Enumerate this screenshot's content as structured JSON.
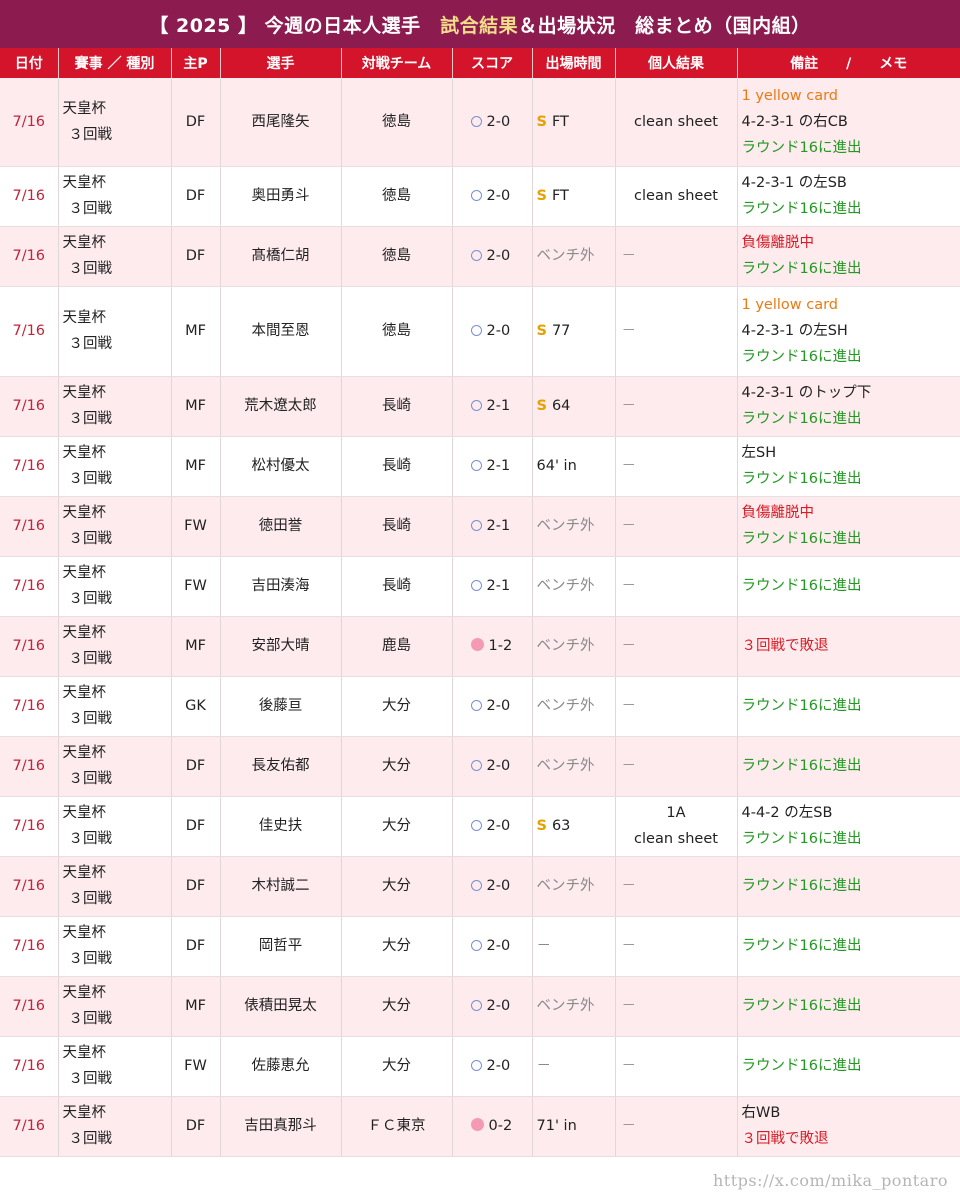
{
  "title": {
    "prefix": "【 2025 】 今週の日本人選手　",
    "highlight": "試合結果",
    "suffix": "＆出場状況　総まとめ（国内組）"
  },
  "headers": [
    "日付",
    "賽事 ／ 種別",
    "主P",
    "選手",
    "対戦チーム",
    "スコア",
    "出場時間",
    "個人結果",
    "備註　　/　　メモ"
  ],
  "rows": [
    {
      "date": "7/16",
      "comp": [
        "天皇杯",
        "３回戦"
      ],
      "pos": "DF",
      "player": "西尾隆矢",
      "opp": "徳島",
      "result": "win",
      "score": "2-0",
      "time_s": true,
      "time": "FT",
      "personal": [
        "clean sheet"
      ],
      "memo": [
        {
          "t": "1 yellow card",
          "c": "orange"
        },
        {
          "t": "4-2-3-1 の右CB",
          "c": "dark"
        },
        {
          "t": "ラウンド16に進出",
          "c": "green"
        }
      ],
      "h": 88
    },
    {
      "date": "7/16",
      "comp": [
        "天皇杯",
        "３回戦"
      ],
      "pos": "DF",
      "player": "奥田勇斗",
      "opp": "徳島",
      "result": "win",
      "score": "2-0",
      "time_s": true,
      "time": "FT",
      "personal": [
        "clean sheet"
      ],
      "memo": [
        {
          "t": "4-2-3-1 の左SB",
          "c": "dark"
        },
        {
          "t": "ラウンド16に進出",
          "c": "green"
        }
      ],
      "h": 60
    },
    {
      "date": "7/16",
      "comp": [
        "天皇杯",
        "３回戦"
      ],
      "pos": "DF",
      "player": "髙橋仁胡",
      "opp": "徳島",
      "result": "win",
      "score": "2-0",
      "time_s": false,
      "time": "ベンチ外",
      "personal": [
        "－"
      ],
      "memo": [
        {
          "t": "負傷離脱中",
          "c": "red"
        },
        {
          "t": "ラウンド16に進出",
          "c": "green"
        }
      ],
      "h": 60
    },
    {
      "date": "7/16",
      "comp": [
        "天皇杯",
        "３回戦"
      ],
      "pos": "MF",
      "player": "本間至恩",
      "opp": "徳島",
      "result": "win",
      "score": "2-0",
      "time_s": true,
      "time": "77",
      "personal": [
        "－"
      ],
      "memo": [
        {
          "t": "1 yellow card",
          "c": "orange"
        },
        {
          "t": "4-2-3-1 の左SH",
          "c": "dark"
        },
        {
          "t": "ラウンド16に進出",
          "c": "green"
        }
      ],
      "h": 90
    },
    {
      "date": "7/16",
      "comp": [
        "天皇杯",
        "３回戦"
      ],
      "pos": "MF",
      "player": "荒木遼太郎",
      "opp": "長崎",
      "result": "win",
      "score": "2-1",
      "time_s": true,
      "time": "64",
      "personal": [
        "－"
      ],
      "memo": [
        {
          "t": "4-2-3-1 のトップ下",
          "c": "dark"
        },
        {
          "t": "ラウンド16に進出",
          "c": "green"
        }
      ],
      "h": 60
    },
    {
      "date": "7/16",
      "comp": [
        "天皇杯",
        "３回戦"
      ],
      "pos": "MF",
      "player": "松村優太",
      "opp": "長崎",
      "result": "win",
      "score": "2-1",
      "time_s": false,
      "time": "64' in",
      "personal": [
        "－"
      ],
      "memo": [
        {
          "t": "左SH",
          "c": "dark"
        },
        {
          "t": "ラウンド16に進出",
          "c": "green"
        }
      ],
      "h": 60
    },
    {
      "date": "7/16",
      "comp": [
        "天皇杯",
        "３回戦"
      ],
      "pos": "FW",
      "player": "徳田誉",
      "opp": "長崎",
      "result": "win",
      "score": "2-1",
      "time_s": false,
      "time": "ベンチ外",
      "personal": [
        "－"
      ],
      "memo": [
        {
          "t": "負傷離脱中",
          "c": "red"
        },
        {
          "t": "ラウンド16に進出",
          "c": "green"
        }
      ],
      "h": 60
    },
    {
      "date": "7/16",
      "comp": [
        "天皇杯",
        "３回戦"
      ],
      "pos": "FW",
      "player": "吉田湊海",
      "opp": "長崎",
      "result": "win",
      "score": "2-1",
      "time_s": false,
      "time": "ベンチ外",
      "personal": [
        "－"
      ],
      "memo": [
        {
          "t": "ラウンド16に進出",
          "c": "green"
        }
      ],
      "h": 60
    },
    {
      "date": "7/16",
      "comp": [
        "天皇杯",
        "３回戦"
      ],
      "pos": "MF",
      "player": "安部大晴",
      "opp": "鹿島",
      "result": "loss",
      "score": "1-2",
      "time_s": false,
      "time": "ベンチ外",
      "personal": [
        "－"
      ],
      "memo": [
        {
          "t": "３回戦で敗退",
          "c": "red"
        }
      ],
      "h": 60
    },
    {
      "date": "7/16",
      "comp": [
        "天皇杯",
        "３回戦"
      ],
      "pos": "GK",
      "player": "後藤亘",
      "opp": "大分",
      "result": "win",
      "score": "2-0",
      "time_s": false,
      "time": "ベンチ外",
      "personal": [
        "－"
      ],
      "memo": [
        {
          "t": "ラウンド16に進出",
          "c": "green"
        }
      ],
      "h": 60
    },
    {
      "date": "7/16",
      "comp": [
        "天皇杯",
        "３回戦"
      ],
      "pos": "DF",
      "player": "長友佑都",
      "opp": "大分",
      "result": "win",
      "score": "2-0",
      "time_s": false,
      "time": "ベンチ外",
      "personal": [
        "－"
      ],
      "memo": [
        {
          "t": "ラウンド16に進出",
          "c": "green"
        }
      ],
      "h": 60
    },
    {
      "date": "7/16",
      "comp": [
        "天皇杯",
        "３回戦"
      ],
      "pos": "DF",
      "player": "佳史扶",
      "opp": "大分",
      "result": "win",
      "score": "2-0",
      "time_s": true,
      "time": "63",
      "personal": [
        "1A",
        "clean sheet"
      ],
      "memo": [
        {
          "t": "4-4-2 の左SB",
          "c": "dark"
        },
        {
          "t": "ラウンド16に進出",
          "c": "green"
        }
      ],
      "h": 60
    },
    {
      "date": "7/16",
      "comp": [
        "天皇杯",
        "３回戦"
      ],
      "pos": "DF",
      "player": "木村誠二",
      "opp": "大分",
      "result": "win",
      "score": "2-0",
      "time_s": false,
      "time": "ベンチ外",
      "personal": [
        "－"
      ],
      "memo": [
        {
          "t": "ラウンド16に進出",
          "c": "green"
        }
      ],
      "h": 60
    },
    {
      "date": "7/16",
      "comp": [
        "天皇杯",
        "３回戦"
      ],
      "pos": "DF",
      "player": "岡哲平",
      "opp": "大分",
      "result": "win",
      "score": "2-0",
      "time_s": false,
      "time": "－",
      "personal": [
        "－"
      ],
      "memo": [
        {
          "t": "ラウンド16に進出",
          "c": "green"
        }
      ],
      "h": 60
    },
    {
      "date": "7/16",
      "comp": [
        "天皇杯",
        "３回戦"
      ],
      "pos": "MF",
      "player": "俵積田晃太",
      "opp": "大分",
      "result": "win",
      "score": "2-0",
      "time_s": false,
      "time": "ベンチ外",
      "personal": [
        "－"
      ],
      "memo": [
        {
          "t": "ラウンド16に進出",
          "c": "green"
        }
      ],
      "h": 60
    },
    {
      "date": "7/16",
      "comp": [
        "天皇杯",
        "３回戦"
      ],
      "pos": "FW",
      "player": "佐藤恵允",
      "opp": "大分",
      "result": "win",
      "score": "2-0",
      "time_s": false,
      "time": "－",
      "personal": [
        "－"
      ],
      "memo": [
        {
          "t": "ラウンド16に進出",
          "c": "green"
        }
      ],
      "h": 60
    },
    {
      "date": "7/16",
      "comp": [
        "天皇杯",
        "３回戦"
      ],
      "pos": "DF",
      "player": "吉田真那斗",
      "opp": "ＦＣ東京",
      "result": "loss",
      "score": "0-2",
      "time_s": false,
      "time": "71' in",
      "personal": [
        "－"
      ],
      "memo": [
        {
          "t": "右WB",
          "c": "dark"
        },
        {
          "t": "３回戦で敗退",
          "c": "red"
        }
      ],
      "h": 60
    }
  ],
  "watermark": "https://x.com/mika_pontaro"
}
